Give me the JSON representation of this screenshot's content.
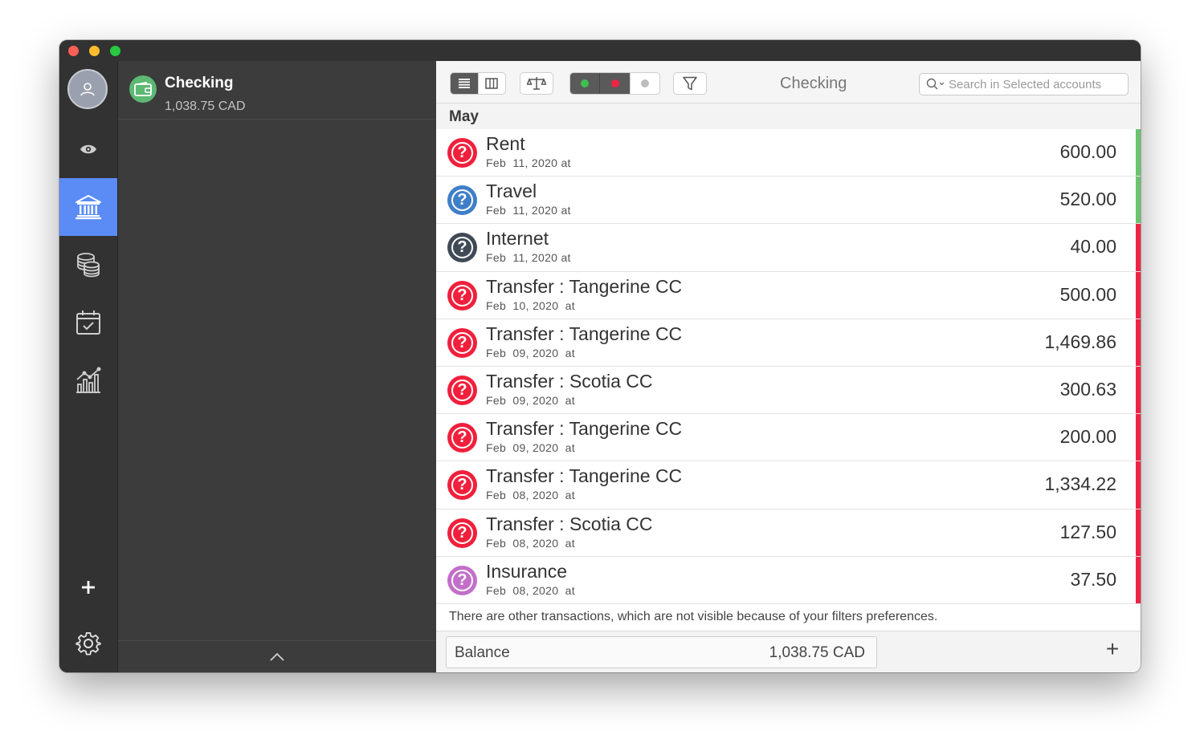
{
  "window": {
    "title_buttons": [
      "close",
      "minimize",
      "maximize"
    ]
  },
  "rail": {
    "items": [
      {
        "name": "overview",
        "icon": "eye-icon"
      },
      {
        "name": "accounts",
        "icon": "bank-icon",
        "active": true
      },
      {
        "name": "budgets",
        "icon": "coins-icon"
      },
      {
        "name": "scheduled",
        "icon": "calendar-check-icon"
      },
      {
        "name": "reports",
        "icon": "chart-icon"
      }
    ],
    "add_icon": "plus-icon",
    "settings_icon": "gear-icon",
    "accent": "#5b8cf6"
  },
  "account": {
    "name": "Checking",
    "balance": "1,038.75 CAD",
    "color": "#5cb872"
  },
  "toolbar": {
    "title": "Checking",
    "search_placeholder": "Search in Selected accounts"
  },
  "section": {
    "label": "May"
  },
  "transactions": [
    {
      "title": "Rent",
      "date": "Feb  11, 2020 at",
      "amount": "600.00",
      "icon_color": "#f0203c",
      "strip": "#6ac46e"
    },
    {
      "title": "Travel",
      "date": "Feb  11, 2020 at",
      "amount": "520.00",
      "icon_color": "#3f7fc8",
      "strip": "#6ac46e"
    },
    {
      "title": "Internet",
      "date": "Feb  11, 2020 at",
      "amount": "40.00",
      "icon_color": "#3f4a56",
      "strip": "#ef2445"
    },
    {
      "title": "Transfer : Tangerine CC",
      "date": "Feb  10, 2020  at",
      "amount": "500.00",
      "icon_color": "#f0203c",
      "strip": "#ef2445"
    },
    {
      "title": "Transfer : Tangerine CC",
      "date": "Feb  09, 2020  at",
      "amount": "1,469.86",
      "icon_color": "#f0203c",
      "strip": "#ef2445"
    },
    {
      "title": "Transfer : Scotia CC",
      "date": "Feb  09, 2020  at",
      "amount": "300.63",
      "icon_color": "#f0203c",
      "strip": "#ef2445"
    },
    {
      "title": "Transfer : Tangerine CC",
      "date": "Feb  09, 2020  at",
      "amount": "200.00",
      "icon_color": "#f0203c",
      "strip": "#ef2445"
    },
    {
      "title": "Transfer : Tangerine CC",
      "date": "Feb  08, 2020  at",
      "amount": "1,334.22",
      "icon_color": "#f0203c",
      "strip": "#ef2445"
    },
    {
      "title": "Transfer : Scotia CC",
      "date": "Feb  08, 2020  at",
      "amount": "127.50",
      "icon_color": "#f0203c",
      "strip": "#ef2445"
    },
    {
      "title": "Insurance",
      "date": "Feb  08, 2020  at",
      "amount": "37.50",
      "icon_color": "#c36fc9",
      "strip": "#ef2445"
    }
  ],
  "notice": "There are other transactions, which are not visible because of your filters preferences.",
  "footer": {
    "balance_label": "Balance",
    "balance_value": "1,038.75 CAD",
    "add_label": "+"
  }
}
